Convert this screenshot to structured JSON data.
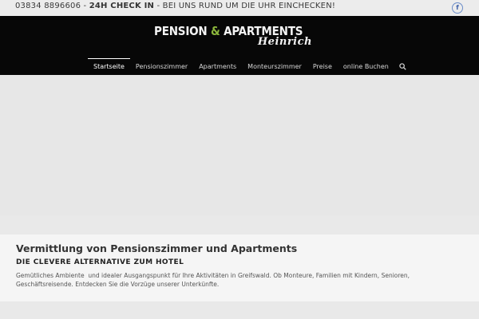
{
  "topbar": {
    "phone": "03834 8896606",
    "sep1": " - ",
    "checkin": "24H CHECK IN",
    "sep2": " - ",
    "tagline": "BEI UNS RUND UM DIE UHR EINCHECKEN!",
    "social_icon": "facebook-icon",
    "social_glyph": "f"
  },
  "logo": {
    "word1": "PENSION ",
    "amp": "&",
    "word2": " APARTMENTS",
    "script": "Heinrich",
    "amp_color": "#8cb63c"
  },
  "nav": {
    "items": [
      {
        "label": "Startseite",
        "active": true
      },
      {
        "label": "Pensionszimmer"
      },
      {
        "label": "Apartments"
      },
      {
        "label": "Monteurszimmer"
      },
      {
        "label": "Preise"
      },
      {
        "label": "online Buchen"
      }
    ],
    "search_icon": "search-icon"
  },
  "intro": {
    "title": "Vermittlung von Pensionszimmer und Apartments",
    "subtitle": "DIE CLEVERE ALTERNATIVE ZUM HOTEL",
    "body": "Gemütliches Ambiente  und idealer Ausgangspunkt für Ihre Aktivitäten in Greifswald. Ob Monteure, Familien mit Kindern, Senioren, Geschäftsreisende. Entdecken Sie die Vorzüge unserer Unterkünfte."
  }
}
